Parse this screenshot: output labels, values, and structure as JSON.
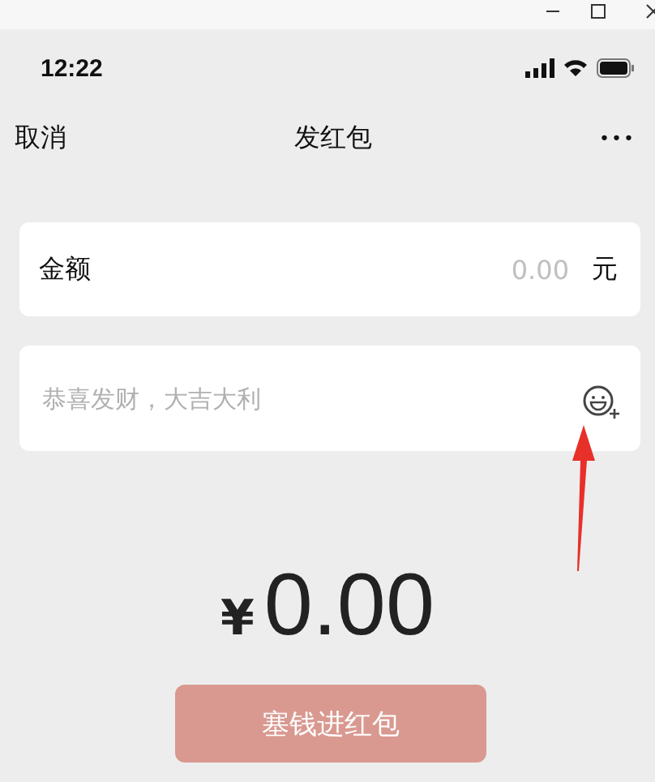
{
  "status_bar": {
    "time": "12:22"
  },
  "nav": {
    "left": "取消",
    "title": "发红包",
    "more": "•••"
  },
  "amount_field": {
    "label": "金额",
    "placeholder": "0.00",
    "unit": "元"
  },
  "greeting_field": {
    "placeholder": "恭喜发财，大吉大利"
  },
  "total": {
    "currency": "¥",
    "amount": "0.00"
  },
  "submit_button": {
    "label": "塞钱进红包",
    "disabled": true
  }
}
